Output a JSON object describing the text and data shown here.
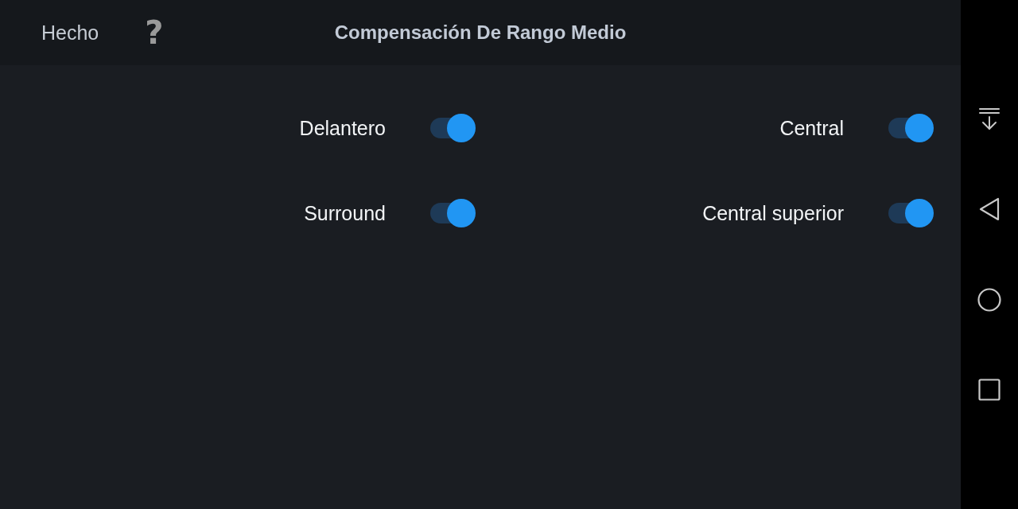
{
  "header": {
    "done": "Hecho",
    "help": "?",
    "title": "Compensación De Rango Medio"
  },
  "switches": [
    {
      "label": "Delantero",
      "on": true
    },
    {
      "label": "Central",
      "on": true
    },
    {
      "label": "Surround",
      "on": true
    },
    {
      "label": "Central superior",
      "on": true
    }
  ]
}
